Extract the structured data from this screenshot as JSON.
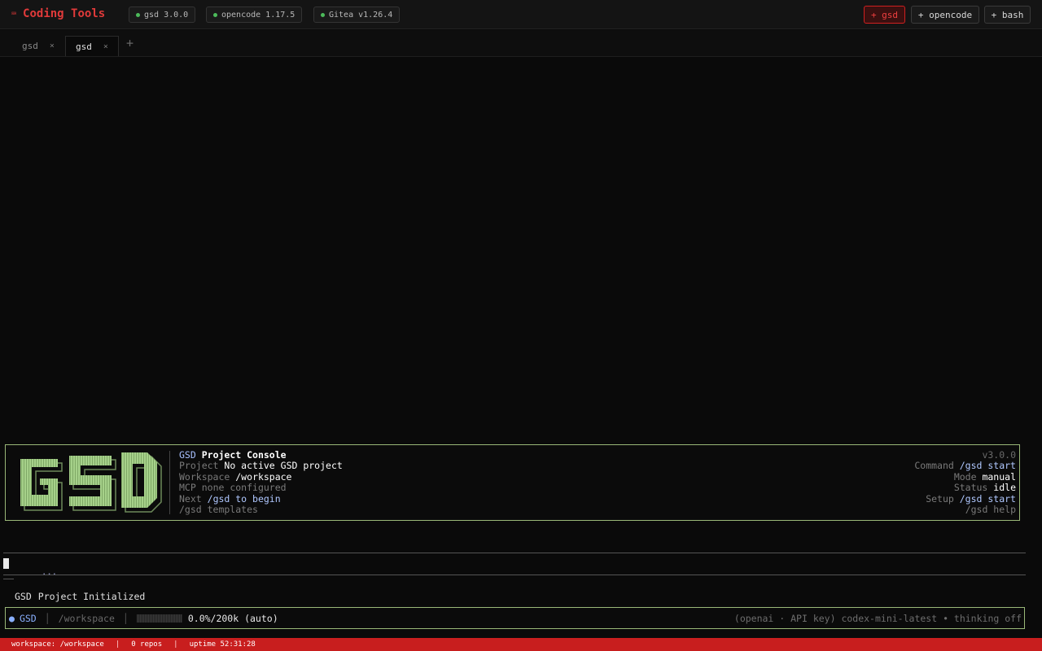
{
  "app": {
    "title": "Coding Tools",
    "icon": "terminal-icon"
  },
  "versions": [
    {
      "label": "gsd 3.0.0"
    },
    {
      "label": "opencode 1.17.5"
    },
    {
      "label": "Gitea v1.26.4"
    }
  ],
  "actions": [
    {
      "label": "+ gsd"
    },
    {
      "label": "+ opencode"
    },
    {
      "label": "+ bash"
    }
  ],
  "tabs": [
    {
      "label": "gsd",
      "close": "×"
    },
    {
      "label": "gsd",
      "close": "×"
    }
  ],
  "tab_add": "+",
  "banner": {
    "logo_text": "GSD",
    "title_prefix": "GSD",
    "title": "Project Console",
    "project_key": "Project",
    "project_value": "No active GSD project",
    "workspace_key": "Workspace",
    "workspace_value": "/workspace",
    "mcp_key": "MCP",
    "mcp_value": "none configured",
    "next_key": "Next",
    "next_value": "/gsd to begin",
    "templates": "/gsd templates",
    "version": "v3.0.0",
    "command_key": "Command",
    "command_value": "/gsd start",
    "mode_key": "Mode",
    "mode_value": "manual",
    "status_key": "Status",
    "status_value": "idle",
    "setup_key": "Setup",
    "setup_value": "/gsd start",
    "help": "/gsd help"
  },
  "spinner": "⠄⠄⠄",
  "status": {
    "name": "GSD",
    "message": "Project Initialized"
  },
  "input": {
    "agent": "GSD",
    "path": "/workspace",
    "context": "0.0%/200k (auto)",
    "model_info": "(openai · API key) codex-mini-latest • thinking off"
  },
  "footer": {
    "workspace": "workspace: /workspace",
    "repos": "0 repos",
    "uptime": "uptime 52:31:28",
    "sep": "|"
  },
  "colors": {
    "accent": "#c81e1e",
    "banner_border": "#9ab878",
    "logo": "#a6d18a"
  }
}
